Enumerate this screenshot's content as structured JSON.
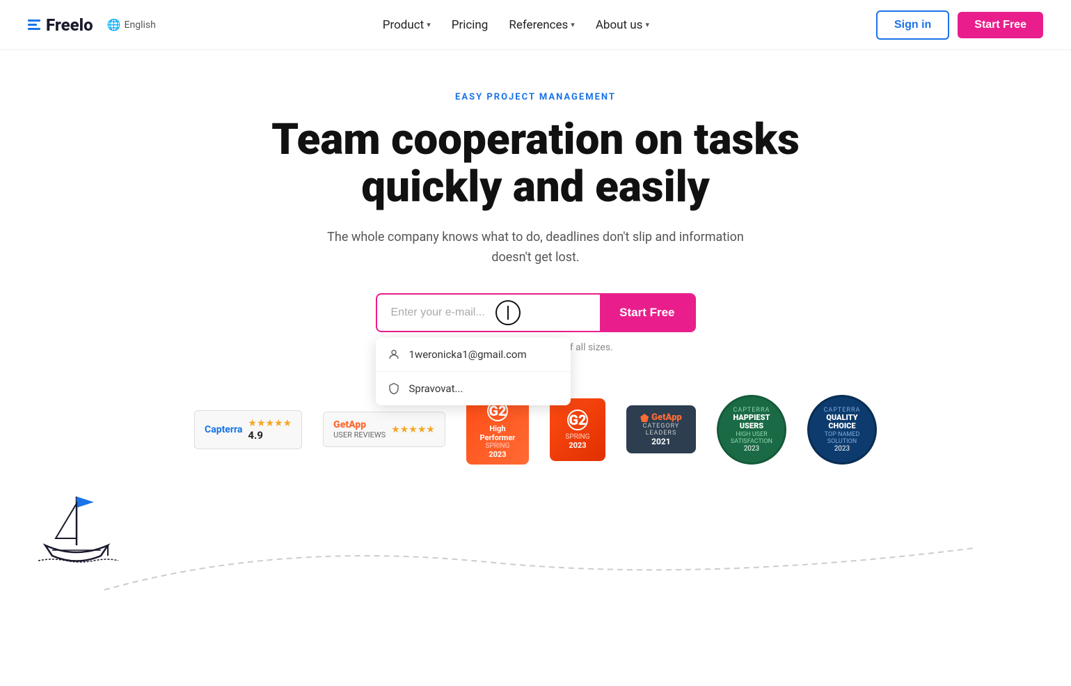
{
  "header": {
    "logo_text": "Freelo",
    "lang": "English",
    "nav": [
      {
        "label": "Product",
        "has_dropdown": true
      },
      {
        "label": "Pricing",
        "has_dropdown": false
      },
      {
        "label": "References",
        "has_dropdown": true
      },
      {
        "label": "About us",
        "has_dropdown": true
      }
    ],
    "signin_label": "Sign in",
    "start_free_label": "Start Free"
  },
  "hero": {
    "badge": "EASY PROJECT MANAGEMENT",
    "title": "Team cooperation on tasks quickly and easily",
    "subtitle": "The whole company knows what to do, deadlines don't slip and information doesn't get lost.",
    "email_placeholder": "Enter your e-mail...",
    "cta_label": "Start Free",
    "for_teams_text": "For teams & businesses of all sizes."
  },
  "autocomplete": {
    "items": [
      {
        "icon": "person",
        "value": "1weronicka1@gmail.com"
      },
      {
        "icon": "shield",
        "value": "Spravovat..."
      }
    ]
  },
  "badges": [
    {
      "id": "capterra",
      "rating": "4.9",
      "label": "Capterra"
    },
    {
      "id": "getapp-reviews",
      "label": "GetApp",
      "sub": "USER REVIEWS"
    },
    {
      "id": "g2-high-performer",
      "title": "High Performer",
      "sub": "SPRING",
      "year": "2023"
    },
    {
      "id": "g2-spring",
      "sub": "SPRING",
      "year": "2023"
    },
    {
      "id": "getapp-leaders",
      "label": "GetApp",
      "sub": "CATEGORY LEADERS",
      "year": "2021"
    },
    {
      "id": "capterra-happiest",
      "brand": "capterra",
      "title": "HAPPIEST USERS",
      "sub": "HIGH USER SATISFACTION",
      "year": "2023"
    },
    {
      "id": "capterra-quality",
      "brand": "capterra",
      "title": "QUALITY CHOICE",
      "sub": "TOP NAMED SOLUTION",
      "year": "2023"
    }
  ]
}
